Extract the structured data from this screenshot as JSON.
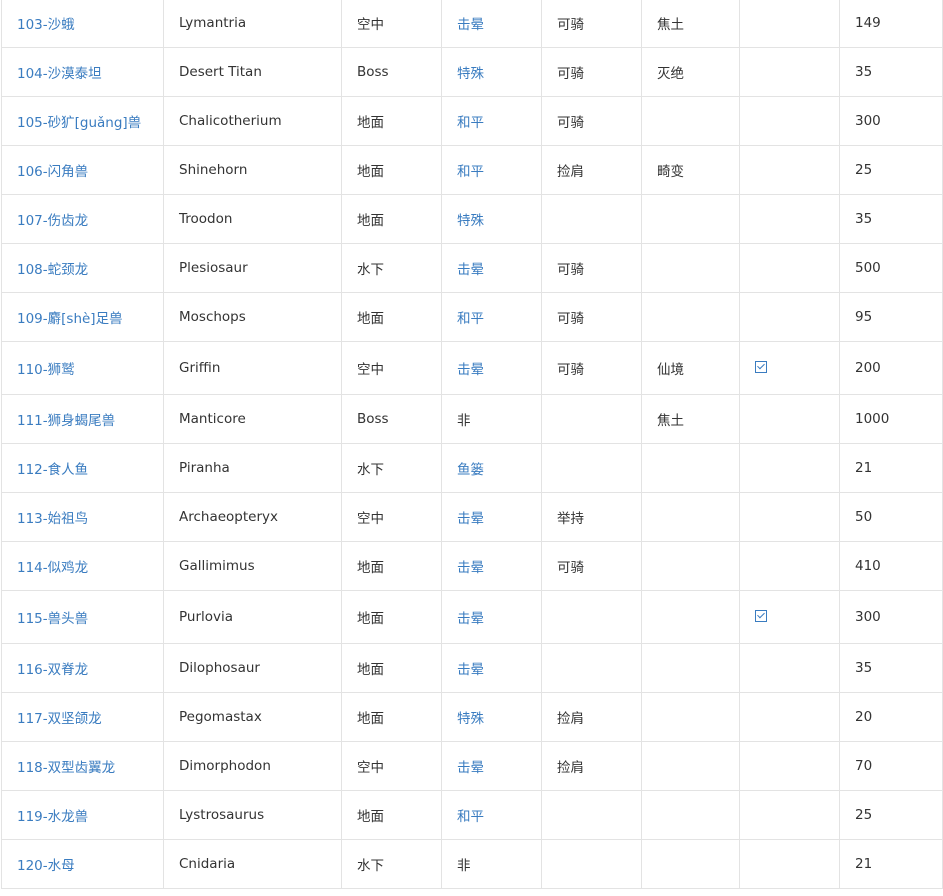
{
  "rows": [
    {
      "name": "103-沙蛾",
      "en": "Lymantria",
      "env": "空中",
      "tame": "击晕",
      "ride": "可骑",
      "map": "焦土",
      "check": false,
      "value": "149"
    },
    {
      "name": "104-沙漠泰坦",
      "en": "Desert Titan",
      "env": "Boss",
      "tame": "特殊",
      "ride": "可骑",
      "map": "灭绝",
      "check": false,
      "value": "35"
    },
    {
      "name": "105-砂犷[guǎng]兽",
      "en": "Chalicotherium",
      "env": "地面",
      "tame": "和平",
      "ride": "可骑",
      "map": "",
      "check": false,
      "value": "300"
    },
    {
      "name": "106-闪角兽",
      "en": "Shinehorn",
      "env": "地面",
      "tame": "和平",
      "ride": "捡肩",
      "map": "畸变",
      "check": false,
      "value": "25"
    },
    {
      "name": "107-伤齿龙",
      "en": "Troodon",
      "env": "地面",
      "tame": "特殊",
      "ride": "",
      "map": "",
      "check": false,
      "value": "35"
    },
    {
      "name": "108-蛇颈龙",
      "en": "Plesiosaur",
      "env": "水下",
      "tame": "击晕",
      "ride": "可骑",
      "map": "",
      "check": false,
      "value": "500"
    },
    {
      "name": "109-麝[shè]足兽",
      "en": "Moschops",
      "env": "地面",
      "tame": "和平",
      "ride": "可骑",
      "map": "",
      "check": false,
      "value": "95"
    },
    {
      "name": "110-狮鹫",
      "en": "Griffin",
      "env": "空中",
      "tame": "击晕",
      "ride": "可骑",
      "map": "仙境",
      "check": true,
      "value": "200"
    },
    {
      "name": "111-狮身蝎尾兽",
      "en": "Manticore",
      "env": "Boss",
      "tame": "非",
      "ride": "",
      "map": "焦土",
      "check": false,
      "value": "1000"
    },
    {
      "name": "112-食人鱼",
      "en": "Piranha",
      "env": "水下",
      "tame": "鱼篓",
      "ride": "",
      "map": "",
      "check": false,
      "value": "21"
    },
    {
      "name": "113-始祖鸟",
      "en": "Archaeopteryx",
      "env": "空中",
      "tame": "击晕",
      "ride": "举持",
      "map": "",
      "check": false,
      "value": "50"
    },
    {
      "name": "114-似鸡龙",
      "en": "Gallimimus",
      "env": "地面",
      "tame": "击晕",
      "ride": "可骑",
      "map": "",
      "check": false,
      "value": "410"
    },
    {
      "name": "115-兽头兽",
      "en": "Purlovia",
      "env": "地面",
      "tame": "击晕",
      "ride": "",
      "map": "",
      "check": true,
      "value": "300"
    },
    {
      "name": "116-双脊龙",
      "en": "Dilophosaur",
      "env": "地面",
      "tame": "击晕",
      "ride": "",
      "map": "",
      "check": false,
      "value": "35"
    },
    {
      "name": "117-双坚颌龙",
      "en": "Pegomastax",
      "env": "地面",
      "tame": "特殊",
      "ride": "捡肩",
      "map": "",
      "check": false,
      "value": "20"
    },
    {
      "name": "118-双型齿翼龙",
      "en": "Dimorphodon",
      "env": "空中",
      "tame": "击晕",
      "ride": "捡肩",
      "map": "",
      "check": false,
      "value": "70"
    },
    {
      "name": "119-水龙兽",
      "en": "Lystrosaurus",
      "env": "地面",
      "tame": "和平",
      "ride": "",
      "map": "",
      "check": false,
      "value": "25"
    },
    {
      "name": "120-水母",
      "en": "Cnidaria",
      "env": "水下",
      "tame": "非",
      "ride": "",
      "map": "",
      "check": false,
      "value": "21"
    }
  ]
}
